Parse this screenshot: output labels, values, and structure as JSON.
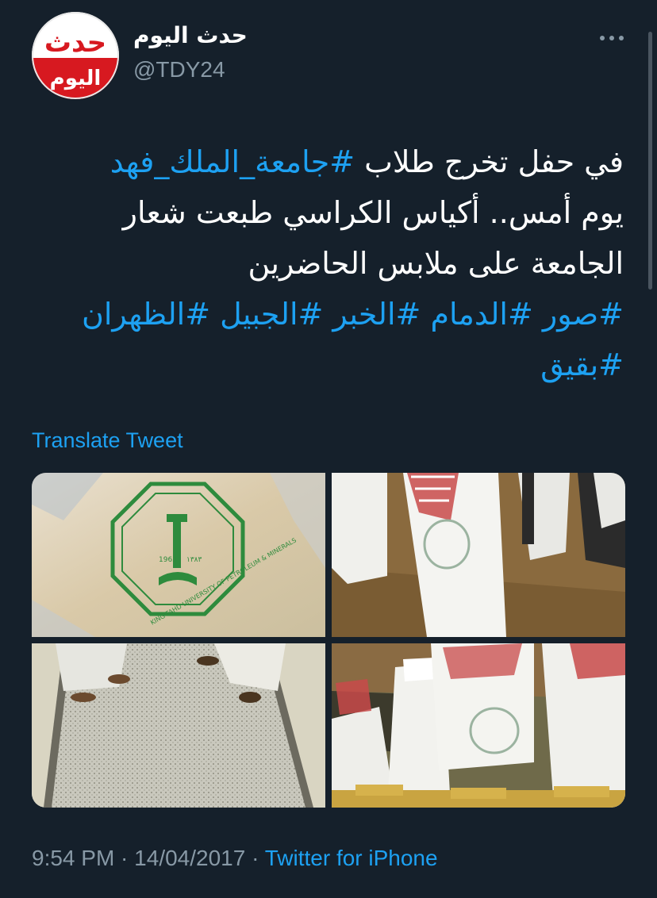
{
  "header": {
    "display_name": "حدث اليوم",
    "handle": "@TDY24",
    "avatar_logo_top": "حدث",
    "avatar_logo_bottom": "اليوم"
  },
  "tweet": {
    "line1_text": "في حفل تخرج طلاب ",
    "line1_hashtag": "#جامعة_الملك_فهد",
    "line2": "يوم أمس..  أكياس الكراسي طبعت شعار",
    "line3": "الجامعة على ملابس  الحاضرين",
    "hashtags_line1": "#صور #الدمام #الخبر #الجبيل #الظهران",
    "hashtags_line2": "#بقيق"
  },
  "translate_label": "Translate Tweet",
  "media": {
    "photo1_caption": "KING FAHD UNIVERSITY OF PETROLEUM & MINERALS",
    "photo1_year": "1963",
    "photo1_year_hijri": "١٣٨٣"
  },
  "footer": {
    "time": "9:54 PM",
    "separator": " · ",
    "date": "14/04/2017",
    "source": "Twitter for iPhone"
  },
  "colors": {
    "background": "#15202b",
    "accent": "#1da1f2",
    "secondary_text": "#8899a6"
  },
  "icons": {
    "more": "more-horizontal-icon"
  }
}
